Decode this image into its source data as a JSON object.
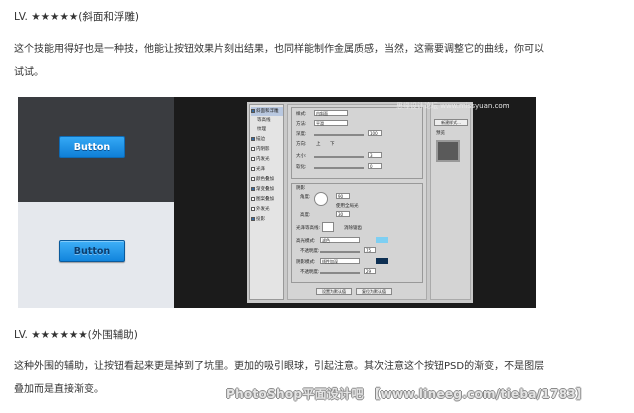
{
  "section1": {
    "title": "LV. ★★★★★(斜面和浮雕)",
    "para_lines": [
      "这个技能用得好也是一种技，他能让按钮效果片刻出结果，也同样能制作金属质感，当然，这需要调整它的曲线，你可以",
      "试试。"
    ]
  },
  "figure": {
    "demo_button_label": "Button",
    "ps_styles": [
      "斜面和浮雕",
      "等高线",
      "纹理",
      "描边",
      "内阴影",
      "内发光",
      "光泽",
      "颜色叠加",
      "渐变叠加",
      "图案叠加",
      "外发光",
      "投影"
    ],
    "ps_styles_checked": [
      true,
      false,
      false,
      true,
      false,
      false,
      false,
      false,
      true,
      false,
      false,
      true
    ],
    "ps_fields": {
      "style_label": "样式:",
      "style_value": "内斜面",
      "method_label": "方法:",
      "method_value": "平滑",
      "depth_label": "深度:",
      "depth_value": "100",
      "direction_label": "方向:",
      "direction_up": "上",
      "direction_down": "下",
      "size_label": "大小:",
      "size_value": "3",
      "soften_label": "软化:",
      "soften_value": "0",
      "shading_title": "阴影",
      "angle_label": "角度:",
      "angle_value": "90",
      "global_light": "使用全局光",
      "altitude_label": "高度:",
      "altitude_value": "30",
      "gloss_label": "光泽等高线:",
      "anti_alias": "消除锯齿",
      "highlight_label": "高光模式:",
      "highlight_mode": "滤色",
      "highlight_opacity": "75",
      "shadow_label": "阴影模式:",
      "shadow_mode": "线性加深",
      "shadow_opacity": "29",
      "opacity_label": "不透明度:",
      "btn_default": "设置为默认值",
      "btn_reset": "复位为默认值",
      "new_style": "新建样式...",
      "preview": "预览"
    },
    "ps_colors": {
      "highlight": "#7ecff2",
      "shadow": "#0d2f52"
    },
    "watermark_top": "思缘设计论坛 www.missyuan.com"
  },
  "section2": {
    "title": "LV. ★★★★★★(外围辅助)",
    "para_lines": [
      "这种外围的辅助，让按钮看起来更是掉到了坑里。更加的吸引眼球，引起注意。其次注意这个按钮PSD的渐变，不是图层",
      "叠加而是直接渐变。"
    ]
  },
  "watermark_bottom": "PhotoShop平面设计吧 【www.lineeg.com/tieba/1783】"
}
